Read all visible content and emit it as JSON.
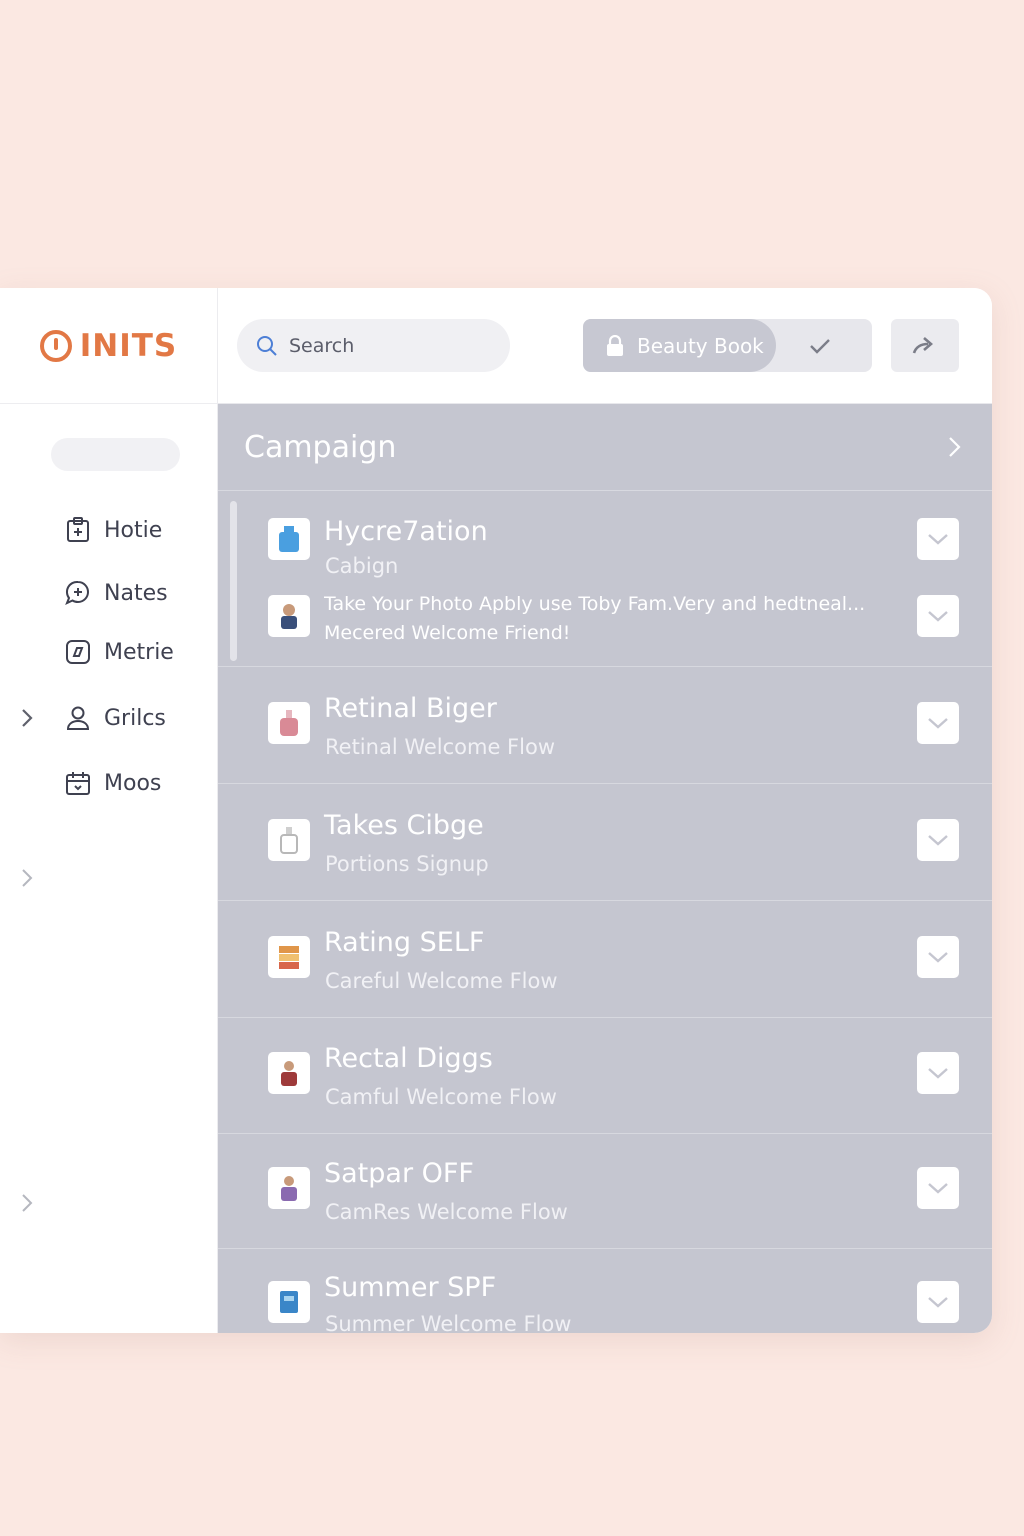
{
  "brand": {
    "name": "INITS",
    "color": "#e27845"
  },
  "sidebar": {
    "items": [
      {
        "label": "Hotie",
        "icon": "clipboard-icon"
      },
      {
        "label": "Nates",
        "icon": "chat-bubble-icon"
      },
      {
        "label": "Metrie",
        "icon": "frame-icon"
      },
      {
        "label": "Grilcs",
        "icon": "user-icon"
      },
      {
        "label": "Moos",
        "icon": "calendar-icon"
      }
    ]
  },
  "topbar": {
    "search_placeholder": "Search",
    "book_label": "Beauty Book"
  },
  "main": {
    "title": "Campaign",
    "rows": [
      {
        "title": "Hycre7ation",
        "subtitle": "Cabign",
        "thumb_color": "#4a9fe0"
      },
      {
        "description_1": "Take Your Photo Apbly use Toby Fam.Very and hedtneal...",
        "description_2": "Mecered Welcome Friend!",
        "thumb_color": "#3a4f7a"
      },
      {
        "title": "Retinal Biger",
        "subtitle": "Retinal Welcome Flow",
        "thumb_color": "#d98a96"
      },
      {
        "title": "Takes Cibge",
        "subtitle": "Portions Signup",
        "thumb_color": "#b8b8b8"
      },
      {
        "title": "Rating SELF",
        "subtitle": "Careful Welcome Flow",
        "thumb_color": "#e0964a"
      },
      {
        "title": "Rectal Diggs",
        "subtitle": "Camful Welcome Flow",
        "thumb_color": "#9e3a3a"
      },
      {
        "title": "Satpar OFF",
        "subtitle": "CamRes Welcome Flow",
        "thumb_color": "#8a6ab0"
      },
      {
        "title": "Summer SPF",
        "subtitle": "Summer Welcome Flow",
        "thumb_color": "#3a86c8"
      }
    ]
  }
}
